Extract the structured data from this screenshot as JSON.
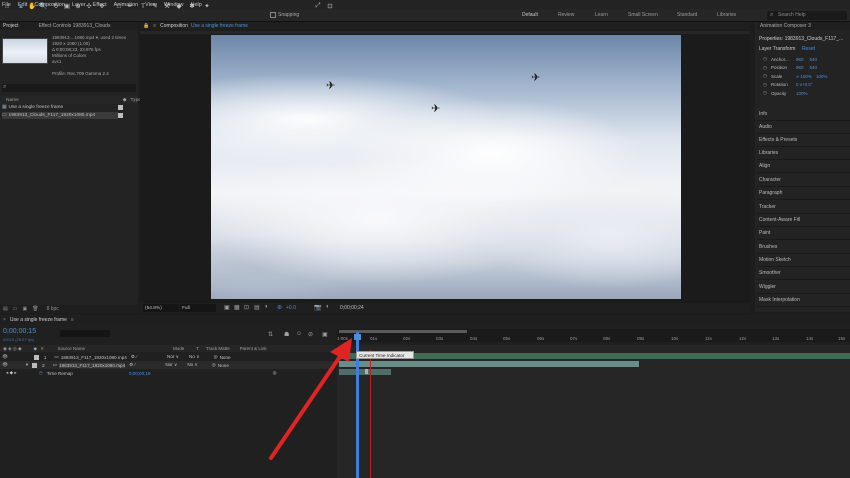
{
  "menu": [
    "File",
    "Edit",
    "Composition",
    "Layer",
    "Effect",
    "Animation",
    "View",
    "Window",
    "Help"
  ],
  "toolbar": {
    "snapping_label": "Snapping",
    "workspaces": [
      "Default",
      "Review",
      "Learn",
      "Small Screen",
      "Standard",
      "Libraries"
    ],
    "search_placeholder": "Search Help"
  },
  "project_panel": {
    "tab_project": "Project",
    "tab_effect_controls": "Effect Controls 1983913_Clouds",
    "file_name": "1983913....1080.mp4 ▾, used 2 times",
    "file_dims": "1920 x 1080 (1.00)",
    "file_duration": "Δ 0;00;08;23, 23.976 fps",
    "file_colors": "Millions of Colors",
    "file_codec": "avc1",
    "profile": "Profile: Rec.709 Gamma 2.4",
    "search_placeholder": "",
    "col_name": "Name",
    "col_type": "Type",
    "items": [
      "Use a single freeze frame",
      "1983913_Clouds_F117_1920x1080.mp4"
    ],
    "footer_label": "8 bpc"
  },
  "composition": {
    "tab_label": "Composition",
    "comp_name": "Use a single freeze frame",
    "zoom": "(54.8%)",
    "resolution": "Full",
    "exposure": "+0.0",
    "timecode": "0;00;00;24"
  },
  "right_panel": {
    "header": "Animation Composer 3",
    "properties_title": "Properties: 1983913_Clouds_F117_...",
    "layer_transform": "Layer Transform",
    "reset": "Reset",
    "props": [
      {
        "name": "Anchor...",
        "v1": "960",
        "v2": "540"
      },
      {
        "name": "Position",
        "v1": "960",
        "v2": "540"
      },
      {
        "name": "Scale",
        "v1": "∞ 100%",
        "v2": "100%"
      },
      {
        "name": "Rotation",
        "v1": "0 x+0.0°",
        "v2": ""
      },
      {
        "name": "Opacity",
        "v1": "100%",
        "v2": ""
      }
    ],
    "panels": [
      "Info",
      "Audio",
      "Effects & Presets",
      "Libraries",
      "Align",
      "Character",
      "Paragraph",
      "Tracker",
      "Content-Aware Fill",
      "Paint",
      "Brushes",
      "Motion Sketch",
      "Smoother",
      "Wiggler",
      "Mask Interpolation"
    ]
  },
  "timeline": {
    "tab_label": "Use a single freeze frame",
    "current_time": "0;00;00;15",
    "frame_info": "00015 (29.97 fps)",
    "col_source": "Source Name",
    "col_mode": "Mode",
    "col_t": "T",
    "col_trkmat": "Track Matte",
    "col_parent": "Parent & Link",
    "layers": [
      {
        "num": "1",
        "name": "1983913_F117_1920x1080.mp4",
        "mode": "Nor ∨",
        "matte": "No ∨",
        "parent": "None"
      },
      {
        "num": "2",
        "name": "1983913_F117_1920x1080.mp4",
        "mode": "Nor ∨",
        "matte": "No ∨",
        "parent": "None"
      }
    ],
    "time_remap_label": "Time Remap",
    "time_remap_value": "0;00;00;19",
    "ruler": [
      "1:00s",
      "01s",
      "02s",
      "03s",
      "04s",
      "05s",
      "06s",
      "07s",
      "08s",
      "09s",
      "10s",
      "11s",
      "12s",
      "13s",
      "14s",
      "15s"
    ],
    "tooltip": "Current Time Indicator"
  },
  "colors": {
    "accent_blue": "#4a90d9",
    "arrow_red": "#e02424",
    "layer1_bar": "#3f6b52",
    "layer2_bar": "#6a8d8a",
    "cti_line": "#3d7fe0"
  }
}
